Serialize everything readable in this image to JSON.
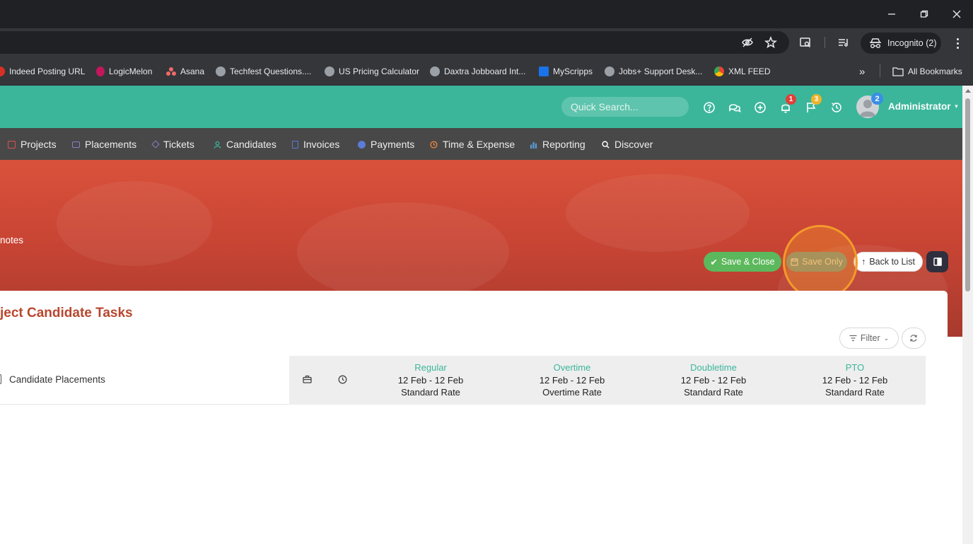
{
  "browser": {
    "incognito_label": "Incognito (2)",
    "bookmarks": [
      {
        "label": "Indeed Posting URL",
        "color": "#d93025"
      },
      {
        "label": "LogicMelon",
        "color": "#c2185b"
      },
      {
        "label": "Asana",
        "color": "#f06a6a"
      },
      {
        "label": "Techfest Questions....",
        "color": "#9aa0a6"
      },
      {
        "label": "US Pricing Calculator",
        "color": "#9aa0a6"
      },
      {
        "label": "Daxtra Jobboard Int...",
        "color": "#9aa0a6"
      },
      {
        "label": "MyScripps",
        "color": "#1a73e8"
      },
      {
        "label": "Jobs+ Support Desk...",
        "color": "#9aa0a6"
      },
      {
        "label": "XML FEED",
        "color": "#34a853"
      }
    ],
    "all_bookmarks_label": "All Bookmarks"
  },
  "header": {
    "search_placeholder": "Quick Search...",
    "notification_count": "1",
    "flag_count": "3",
    "avatar_badge": "2",
    "user_name": "Administrator"
  },
  "nav": {
    "items": [
      {
        "label": "Projects",
        "icon": "project-icon",
        "color": "#e05050"
      },
      {
        "label": "Placements",
        "icon": "briefcase-icon",
        "color": "#8e7cc3"
      },
      {
        "label": "Tickets",
        "icon": "tag-icon",
        "color": "#8e7cc3"
      },
      {
        "label": "Candidates",
        "icon": "user-icon",
        "color": "#3bb69b"
      },
      {
        "label": "Invoices",
        "icon": "invoice-icon",
        "color": "#5b7bd5"
      },
      {
        "label": "Payments",
        "icon": "payment-icon",
        "color": "#5b7bd5"
      },
      {
        "label": "Time & Expense",
        "icon": "clock-icon",
        "color": "#f0883e"
      },
      {
        "label": "Reporting",
        "icon": "bar-chart-icon",
        "color": "#5b9bd5"
      },
      {
        "label": "Discover",
        "icon": "search-icon",
        "color": "#ffffff"
      }
    ]
  },
  "hero": {
    "text": "notes",
    "save_close_label": "Save & Close",
    "save_only_label": "Save Only",
    "back_label": "Back to List"
  },
  "main": {
    "title": "ject Candidate Tasks",
    "filter_label": "Filter",
    "row_label": "Candidate Placements",
    "rates": [
      {
        "type": "Regular",
        "dates": "12 Feb - 12 Feb",
        "rate": "Standard Rate"
      },
      {
        "type": "Overtime",
        "dates": "12 Feb - 12 Feb",
        "rate": "Overtime Rate"
      },
      {
        "type": "Doubletime",
        "dates": "12 Feb - 12 Feb",
        "rate": "Standard Rate"
      },
      {
        "type": "PTO",
        "dates": "12 Feb - 12 Feb",
        "rate": "Standard Rate"
      }
    ]
  },
  "colors": {
    "header_teal": "#3bb69b",
    "nav_gray": "#484848",
    "hero_red": "#d9523b",
    "title_red": "#b8472f",
    "save_green": "#5cb85c",
    "highlight_orange": "#f39a2b"
  }
}
